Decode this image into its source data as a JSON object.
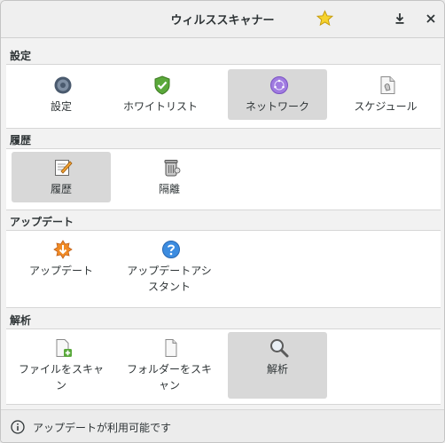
{
  "window": {
    "title": "ウィルススキャナー"
  },
  "sections": [
    {
      "header": "設定",
      "items": [
        {
          "label": "設定",
          "icon": "gear-icon",
          "selected": false
        },
        {
          "label": "ホワイトリスト",
          "icon": "shield-check-icon",
          "selected": false
        },
        {
          "label": "ネットワーク",
          "icon": "network-globe-icon",
          "selected": true
        },
        {
          "label": "スケジュール",
          "icon": "schedule-icon",
          "selected": false
        }
      ]
    },
    {
      "header": "履歴",
      "items": [
        {
          "label": "履歴",
          "icon": "history-notepad-icon",
          "selected": true
        },
        {
          "label": "隔離",
          "icon": "quarantine-bin-icon",
          "selected": false
        }
      ]
    },
    {
      "header": "アップデート",
      "items": [
        {
          "label": "アップデート",
          "icon": "update-star-icon",
          "selected": false
        },
        {
          "label": "アップデートアシスタント",
          "icon": "help-icon",
          "selected": false
        }
      ]
    },
    {
      "header": "解析",
      "items": [
        {
          "label": "ファイルをスキャン",
          "icon": "scan-file-icon",
          "selected": false
        },
        {
          "label": "フォルダーをスキャン",
          "icon": "scan-folder-icon",
          "selected": false
        },
        {
          "label": "解析",
          "icon": "magnifier-icon",
          "selected": true
        }
      ]
    }
  ],
  "infobar": {
    "message": "アップデートが利用可能です",
    "icon": "info-icon"
  }
}
